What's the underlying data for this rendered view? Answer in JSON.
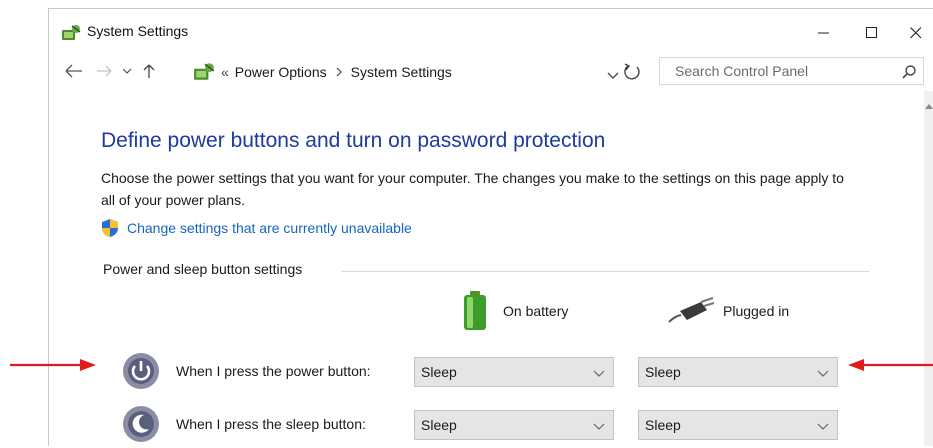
{
  "window": {
    "title": "System Settings",
    "controls": [
      "minimize",
      "maximize",
      "close"
    ]
  },
  "nav": {
    "path_prefix": "«",
    "path": [
      "Power Options",
      "System Settings"
    ],
    "search_placeholder": "Search Control Panel"
  },
  "page": {
    "heading": "Define power buttons and turn on password protection",
    "description": "Choose the power settings that you want for your computer. The changes you make to the settings on this page apply to all of your power plans.",
    "admin_link": "Change settings that are currently unavailable",
    "group_label": "Power and sleep button settings",
    "columns": {
      "battery": "On battery",
      "plugged": "Plugged in"
    },
    "rows": [
      {
        "label": "When I press the power button:",
        "on_battery": "Sleep",
        "plugged_in": "Sleep"
      },
      {
        "label": "When I press the sleep button:",
        "on_battery": "Sleep",
        "plugged_in": "Sleep"
      }
    ]
  },
  "icons": {
    "app": "control-panel-icon",
    "shield": "uac-shield-icon",
    "battery": "battery-icon",
    "plug": "power-plug-icon",
    "power_button": "power-button-icon",
    "sleep_button": "sleep-button-icon"
  },
  "colors": {
    "heading": "#1e3aa0",
    "link": "#1565c0",
    "annotation_arrow": "#e11b1b",
    "select_bg": "#e5e5e5"
  }
}
